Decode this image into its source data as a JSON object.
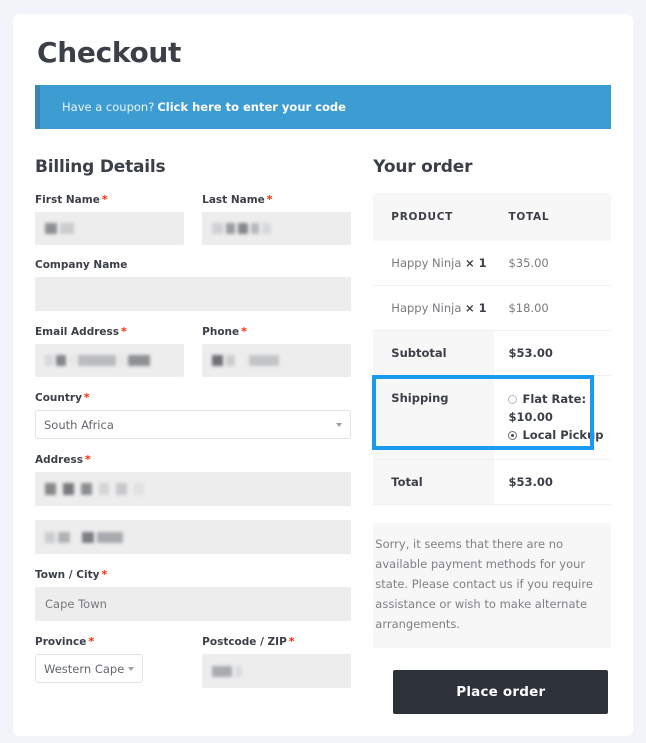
{
  "page": {
    "title": "Checkout"
  },
  "coupon": {
    "prompt": "Have a coupon?",
    "link_label": "Click here to enter your code"
  },
  "billing": {
    "heading": "Billing Details",
    "fields": {
      "first_name": {
        "label": "First Name",
        "required": "*",
        "value": ""
      },
      "last_name": {
        "label": "Last Name",
        "required": "*",
        "value": ""
      },
      "company_name": {
        "label": "Company Name",
        "required": "",
        "value": ""
      },
      "email": {
        "label": "Email Address",
        "required": "*",
        "value": ""
      },
      "phone": {
        "label": "Phone",
        "required": "*",
        "value": ""
      },
      "country": {
        "label": "Country",
        "required": "*",
        "value": "South Africa"
      },
      "address1": {
        "label": "Address",
        "required": "*",
        "value": ""
      },
      "address2": {
        "label": "",
        "required": "",
        "value": ""
      },
      "city": {
        "label": "Town / City",
        "required": "*",
        "value": "Cape Town"
      },
      "province": {
        "label": "Province",
        "required": "*",
        "value": "Western Cape"
      },
      "postcode": {
        "label": "Postcode / ZIP",
        "required": "*",
        "value": ""
      }
    }
  },
  "order": {
    "heading": "Your order",
    "columns": {
      "product": "PRODUCT",
      "total": "TOTAL"
    },
    "items": [
      {
        "name": "Happy Ninja",
        "qty": "× 1",
        "total": "$35.00"
      },
      {
        "name": "Happy Ninja",
        "qty": "× 1",
        "total": "$18.00"
      }
    ],
    "subtotal": {
      "label": "Subtotal",
      "value": "$53.00"
    },
    "shipping": {
      "label": "Shipping",
      "options": [
        {
          "label": "Flat Rate:",
          "price": "$10.00",
          "selected": false
        },
        {
          "label": "Local Pickup",
          "price": "",
          "selected": true
        }
      ]
    },
    "total": {
      "label": "Total",
      "value": "$53.00"
    },
    "notice": "Sorry, it seems that there are no available payment methods for your state. Please contact us if you require assistance or wish to make alternate arrangements.",
    "place_order_label": "Place order"
  },
  "colors": {
    "coupon_bar": "#3d9cd2",
    "coupon_accent": "#3687b8",
    "highlight": "#1a9bf0",
    "button": "#2d3139",
    "required": "#ff2a00",
    "page_bg": "#f2f4fa"
  }
}
